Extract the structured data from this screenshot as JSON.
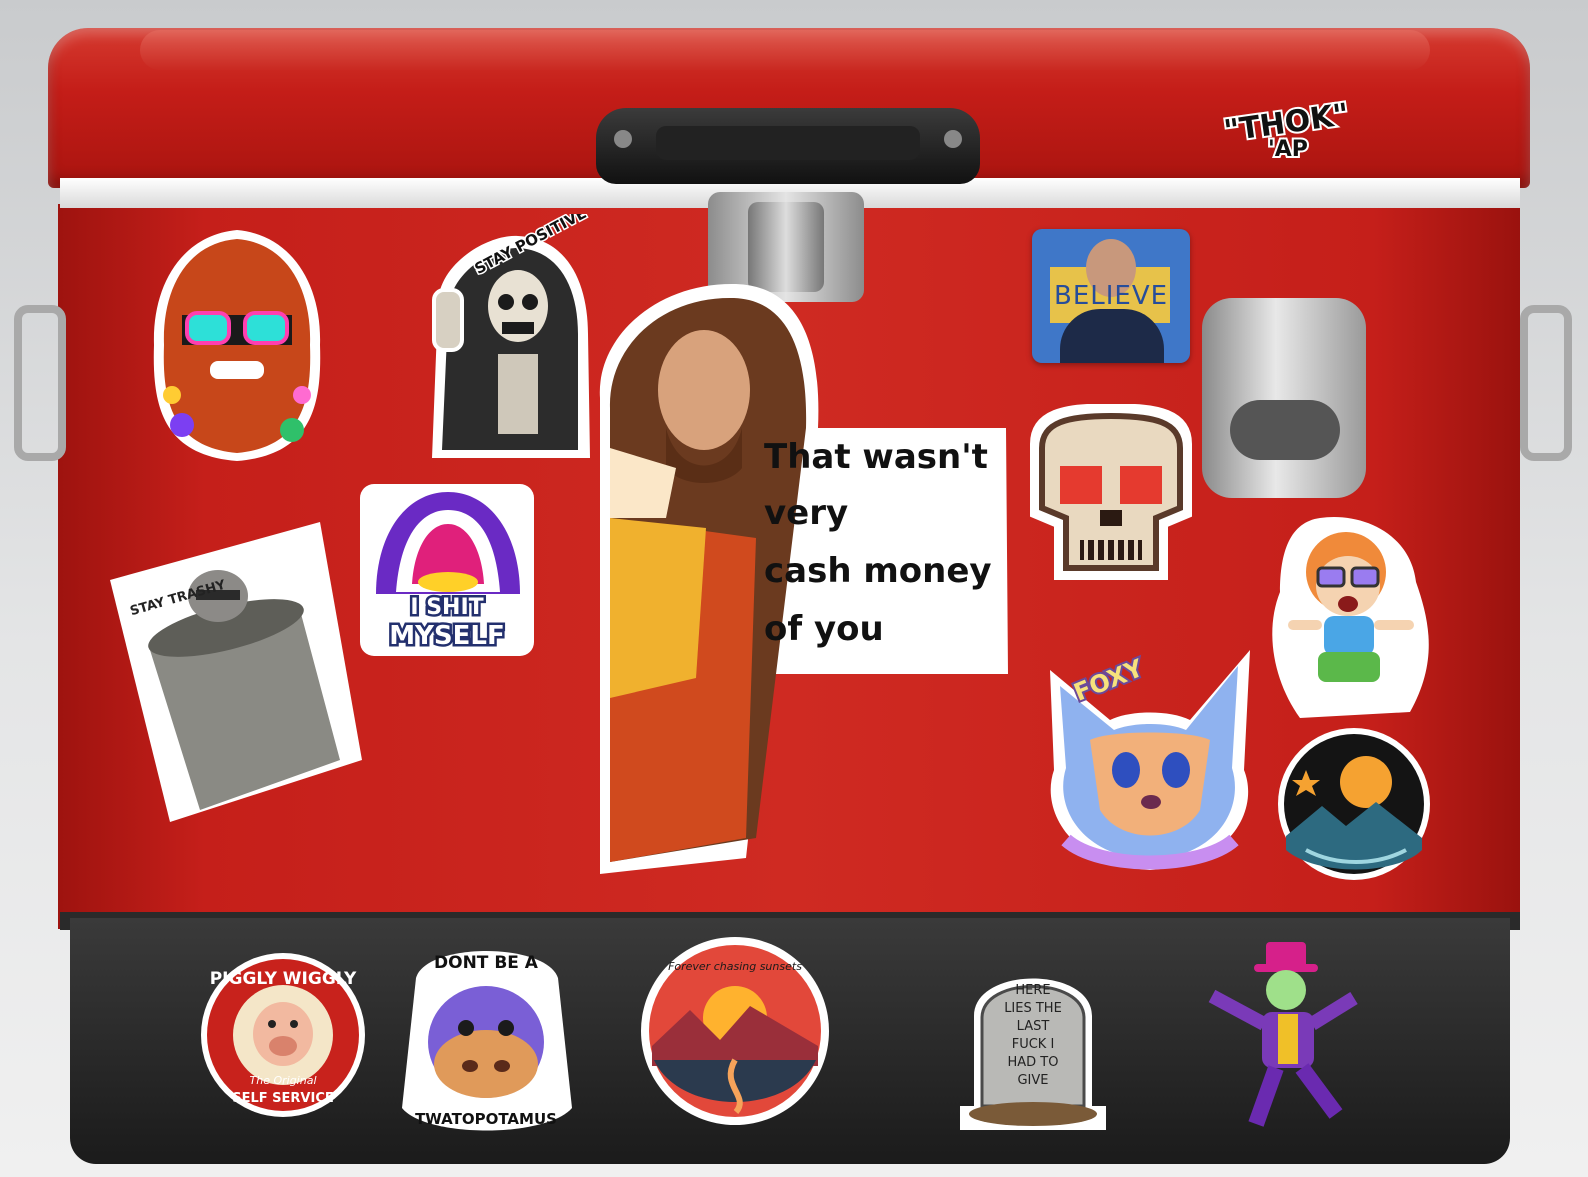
{
  "stickers": {
    "thik_ap": {
      "line1": "\"THOK\"",
      "line2": "'AP"
    },
    "stay_positive": {
      "text": "STAY POSITIVE"
    },
    "believe": {
      "text": "BELIEVE"
    },
    "taco_bell": {
      "line1": "I SHIT",
      "line2": "MYSELF"
    },
    "raccoon": {
      "text": "STAY TRASHY"
    },
    "jesus": {
      "line1": "That wasn't",
      "line2": "very",
      "line3": "cash money",
      "line4": "of you"
    },
    "foxy": {
      "text": "FOXY"
    },
    "piggly_wiggly": {
      "line1": "PIGGLY WIGGLY",
      "line2": "The Original",
      "line3": "SELF SERVICE"
    },
    "hippo": {
      "line1": "DONT BE A",
      "line2": "TWATOPOTAMUS"
    },
    "sunset": {
      "text": "Forever chasing sunsets"
    },
    "tombstone": {
      "line1": "HERE",
      "line2": "LIES THE",
      "line3": "LAST",
      "line4": "FUCK I",
      "line5": "HAD TO",
      "line6": "GIVE"
    }
  },
  "colors": {
    "cooler_red": "#c51f1a",
    "cooler_black": "#1b1b1b",
    "lid_band": "#ffffff"
  }
}
